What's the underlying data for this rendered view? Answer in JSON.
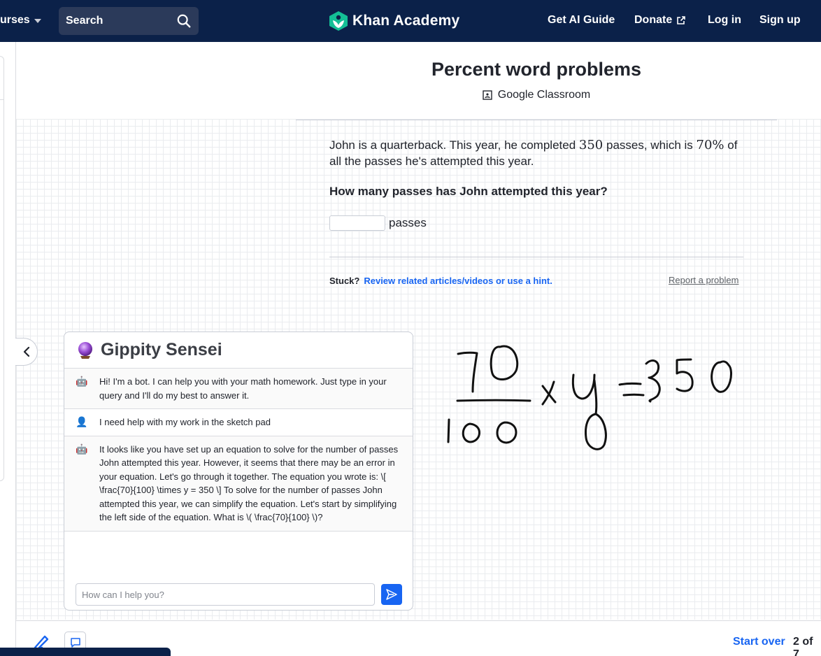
{
  "nav": {
    "courses_label": "urses",
    "search_label": "Search",
    "logo_text": "Khan Academy",
    "ai_guide_label": "Get AI Guide",
    "donate_label": "Donate",
    "login_label": "Log in",
    "signup_label": "Sign up"
  },
  "exercise": {
    "title": "Percent word problems",
    "classroom_label": "Google Classroom",
    "problem_text_1": "John is a quarterback. This year, he completed",
    "problem_value_1": "350",
    "problem_text_2": "passes, which is",
    "problem_value_2": "70%",
    "problem_text_3": "of all the passes he's attempted this year.",
    "question": "How many passes has John attempted this year?",
    "answer_value": "",
    "answer_unit": "passes",
    "stuck_label": "Stuck?",
    "help_link": "Review related articles/videos or use a hint.",
    "report_link": "Report a problem"
  },
  "chat": {
    "title": "Gippity Sensei",
    "messages": [
      {
        "role": "bot",
        "text": "Hi! I'm a bot. I can help you with your math homework. Just type in your query and I'll do my best to answer it."
      },
      {
        "role": "user",
        "text": "I need help with my work in the sketch pad"
      },
      {
        "role": "bot",
        "text": "It looks like you have set up an equation to solve for the number of passes John attempted this year. However, it seems that there may be an error in your equation. Let's go through it together. The equation you wrote is: \\[ \\frac{70}{100} \\times y = 350 \\] To solve for the number of passes John attempted this year, we can simplify the equation. Let's start by simplifying the left side of the equation. What is \\( \\frac{70}{100} \\)?"
      }
    ],
    "input_placeholder": "How can I help you?",
    "input_value": ""
  },
  "footer": {
    "start_over_label": "Start over",
    "progress_label": "2 of 7"
  },
  "colors": {
    "nav_bg": "#0b2149",
    "accent": "#1865f2",
    "logo_green": "#14bf96"
  },
  "icons": [
    "chevron-down-icon",
    "search-icon",
    "khan-logo-icon",
    "external-link-icon",
    "google-classroom-icon",
    "chevron-left-icon",
    "crystal-ball-icon",
    "robot-icon",
    "user-icon",
    "send-icon",
    "pencil-icon",
    "chat-bubble-icon"
  ]
}
